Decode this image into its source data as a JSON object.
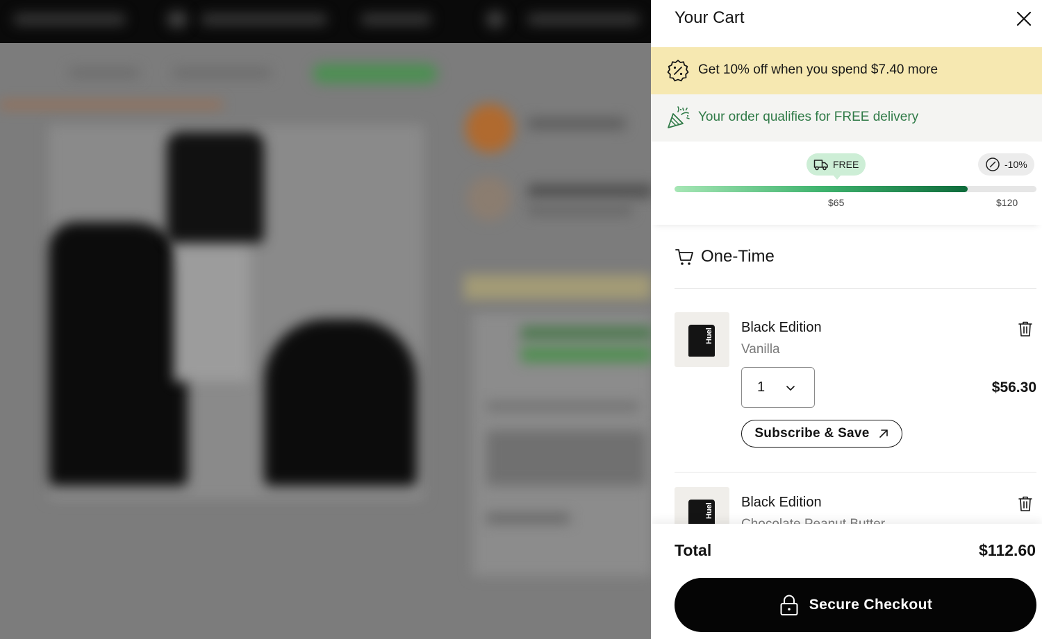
{
  "background_page": {
    "description_colors": {
      "topbar": "#0a0a0a",
      "overlay": "#7c7c7c",
      "accent_green": "#4c8f52"
    }
  },
  "cart": {
    "title": "Your Cart",
    "close_icon": "close-icon",
    "promo": {
      "icon": "discount-badge-icon",
      "text": "Get 10% off when you spend $7.40 more",
      "bg_color": "#f6e8b1"
    },
    "delivery": {
      "icon": "party-popper-icon",
      "text": "Your order qualifies for FREE delivery",
      "text_color": "#2f7a47"
    },
    "progress": {
      "free_label": "FREE",
      "free_icon": "truck-icon",
      "discount_label": "-10%",
      "discount_icon": "discount-check-icon",
      "mark_65": "$65",
      "mark_120": "$120",
      "fill_fraction": 0.81
    },
    "section": {
      "icon": "cart-icon",
      "title": "One-Time"
    },
    "items": [
      {
        "name": "Black Edition",
        "variant": "Vanilla",
        "brand": "Huel",
        "quantity": "1",
        "price": "$56.30",
        "subscribe_label": "Subscribe & Save"
      },
      {
        "name": "Black Edition",
        "variant": "Chocolate Peanut Butter",
        "brand": "Huel"
      }
    ],
    "footer": {
      "total_label": "Total",
      "total_value": "$112.60",
      "checkout_label": "Secure Checkout",
      "checkout_icon": "lock-icon"
    }
  }
}
